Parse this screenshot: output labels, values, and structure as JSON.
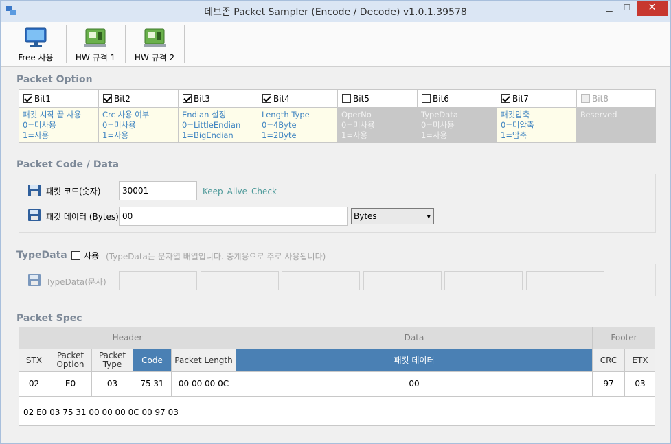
{
  "window": {
    "title": "데브존 Packet Sampler (Encode / Decode) v1.0.1.39578",
    "min": "▁",
    "max": "☐",
    "close": "✕"
  },
  "toolbar": {
    "items": [
      {
        "label": "Free 사용"
      },
      {
        "label": "HW 규격 1"
      },
      {
        "label": "HW 규격 2"
      }
    ]
  },
  "packet_option": {
    "title": "Packet Option",
    "bits": [
      {
        "label": "Bit1",
        "checked": true,
        "enabled": true,
        "desc": [
          "패킷 시작 끝 사용",
          "0=미사용",
          "1=사용"
        ]
      },
      {
        "label": "Bit2",
        "checked": true,
        "enabled": true,
        "desc": [
          "Crc 사용 여부",
          "0=미사용",
          "1=사용"
        ]
      },
      {
        "label": "Bit3",
        "checked": true,
        "enabled": true,
        "desc": [
          "Endian 설정",
          "0=LittleEndian",
          "1=BigEndian"
        ]
      },
      {
        "label": "Bit4",
        "checked": true,
        "enabled": true,
        "desc": [
          "Length Type",
          "0=4Byte",
          "1=2Byte"
        ]
      },
      {
        "label": "Bit5",
        "checked": false,
        "enabled": true,
        "desc": [
          "OperNo",
          "0=미사용",
          "1=사용"
        ]
      },
      {
        "label": "Bit6",
        "checked": false,
        "enabled": true,
        "desc": [
          "TypeData",
          "0=미사용",
          "1=사용"
        ]
      },
      {
        "label": "Bit7",
        "checked": true,
        "enabled": true,
        "desc": [
          "패킷압축",
          "0=미압축",
          "1=압축"
        ]
      },
      {
        "label": "Bit8",
        "checked": false,
        "enabled": false,
        "desc": [
          "Reserved",
          "",
          ""
        ]
      }
    ]
  },
  "code_data": {
    "title": "Packet Code / Data",
    "code_label": "패킷 코드(숫자)",
    "code_value": "30001",
    "code_name": "Keep_Alive_Check",
    "data_label": "패킷 데이터 (Bytes)",
    "data_value": "00",
    "data_format": "Bytes"
  },
  "type_data": {
    "title": "TypeData",
    "use_label": "사용",
    "use_checked": false,
    "hint": "(TypeData는 문자열 배열입니다. 중계용으로 주로 사용됩니다)",
    "field_label": "TypeData(문자)",
    "fields": [
      "",
      "",
      "",
      "",
      "",
      ""
    ]
  },
  "spec": {
    "title": "Packet Spec",
    "groups": {
      "header": "Header",
      "data": "Data",
      "footer": "Footer"
    },
    "columns": {
      "stx": "STX",
      "option": "Packet Option",
      "type": "Packet Type",
      "code": "Code",
      "length": "Packet Length",
      "data": "패킷 데이터",
      "crc": "CRC",
      "etx": "ETX"
    },
    "values": {
      "stx": "02",
      "option": "E0",
      "type": "03",
      "code": "75 31",
      "length": "00 00 00 0C",
      "data": "00",
      "crc": "97",
      "etx": "03"
    },
    "raw": "02 E0 03 75 31 00 00 00 0C 00 97 03"
  },
  "colors": {
    "accent": "#4a80b4",
    "desc_text": "#3f84c1",
    "desc_bg": "#fefdea",
    "section_title": "#7d8998"
  }
}
